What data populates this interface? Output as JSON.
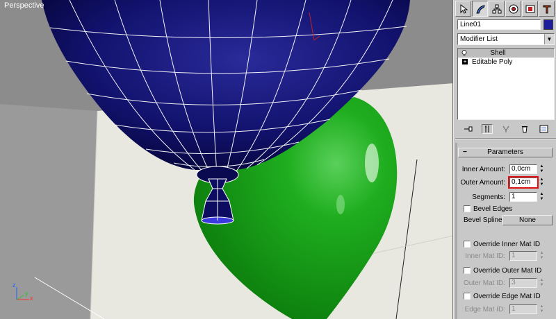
{
  "viewport": {
    "label": "Perspective",
    "axis_x": "x",
    "axis_y": "y",
    "axis_z": "z"
  },
  "tabs": [
    {
      "name": "create-tab-icon",
      "active": false
    },
    {
      "name": "modify-tab-icon",
      "active": true
    },
    {
      "name": "hierarchy-tab-icon",
      "active": false
    },
    {
      "name": "motion-tab-icon",
      "active": false
    },
    {
      "name": "display-tab-icon",
      "active": false
    },
    {
      "name": "utilities-tab-icon",
      "active": false
    }
  ],
  "object": {
    "name": "Line01",
    "color": "#1e1e9c"
  },
  "modifier_list": {
    "selected": "Modifier List"
  },
  "stack": {
    "items": [
      {
        "label": "Shell",
        "selected": true
      },
      {
        "label": "Editable Poly",
        "selected": false
      }
    ]
  },
  "parameters": {
    "title": "Parameters",
    "inner_amount": {
      "label": "Inner Amount:",
      "value": "0,0cm"
    },
    "outer_amount": {
      "label": "Outer Amount:",
      "value": "0,1cm"
    },
    "segments": {
      "label": "Segments:",
      "value": "1"
    },
    "bevel_edges": {
      "label": "Bevel Edges",
      "checked": false
    },
    "bevel_spline": {
      "label": "Bevel Spline:",
      "button": "None"
    },
    "override_inner": {
      "label": "Override Inner Mat ID",
      "checked": false
    },
    "inner_mat_id": {
      "label": "Inner Mat ID:",
      "value": "1"
    },
    "override_outer": {
      "label": "Override Outer Mat ID",
      "checked": false
    },
    "outer_mat_id": {
      "label": "Outer Mat ID:",
      "value": "3"
    },
    "override_edge": {
      "label": "Override Edge Mat ID",
      "checked": false
    },
    "edge_mat_id": {
      "label": "Edge Mat ID:",
      "value": "1"
    }
  },
  "colors": {
    "balloon_blue": "#0e0e6e",
    "balloon_green": "#1aa01a",
    "highlight_red": "#e01010"
  }
}
